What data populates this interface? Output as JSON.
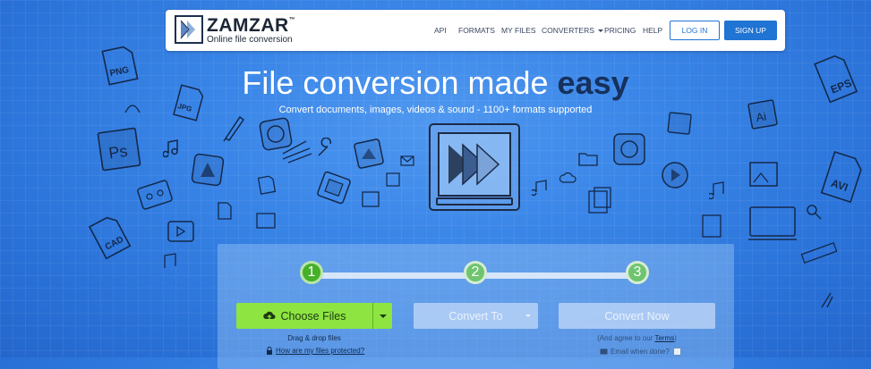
{
  "header": {
    "brand": "ZAMZAR",
    "brand_tm": "™",
    "tagline": "Online file conversion",
    "nav": [
      {
        "label": "API"
      },
      {
        "label": "FORMATS"
      },
      {
        "label": "MY FILES"
      },
      {
        "label": "CONVERTERS"
      },
      {
        "label": "PRICING"
      },
      {
        "label": "HELP"
      }
    ],
    "login_label": "LOG IN",
    "signup_label": "SIGN UP"
  },
  "hero": {
    "title_plain": "File conversion made ",
    "title_bold": "easy",
    "subtitle": "Convert documents, images, videos & sound - 1100+ formats supported"
  },
  "doodles": {
    "png": "PNG",
    "jpg": "JPG",
    "ps": "Ps",
    "cad": "CAD",
    "eps": "EPS",
    "ai": "Ai",
    "avi": "AVI"
  },
  "converter": {
    "steps": [
      "1",
      "2",
      "3"
    ],
    "choose_files_label": "Choose Files",
    "drag_drop_text": "Drag & drop files",
    "protected_link": "How are my files protected?",
    "convert_to_label": "Convert To",
    "convert_now_label": "Convert Now",
    "agree_text": "(And agree to our ",
    "terms_link": "Terms",
    "agree_close": ")",
    "email_label": "Email when done?"
  },
  "colors": {
    "background": "#2f7be0",
    "accent_blue": "#1f74d4",
    "choose_green": "#8ee542",
    "step_active": "#46b028"
  }
}
